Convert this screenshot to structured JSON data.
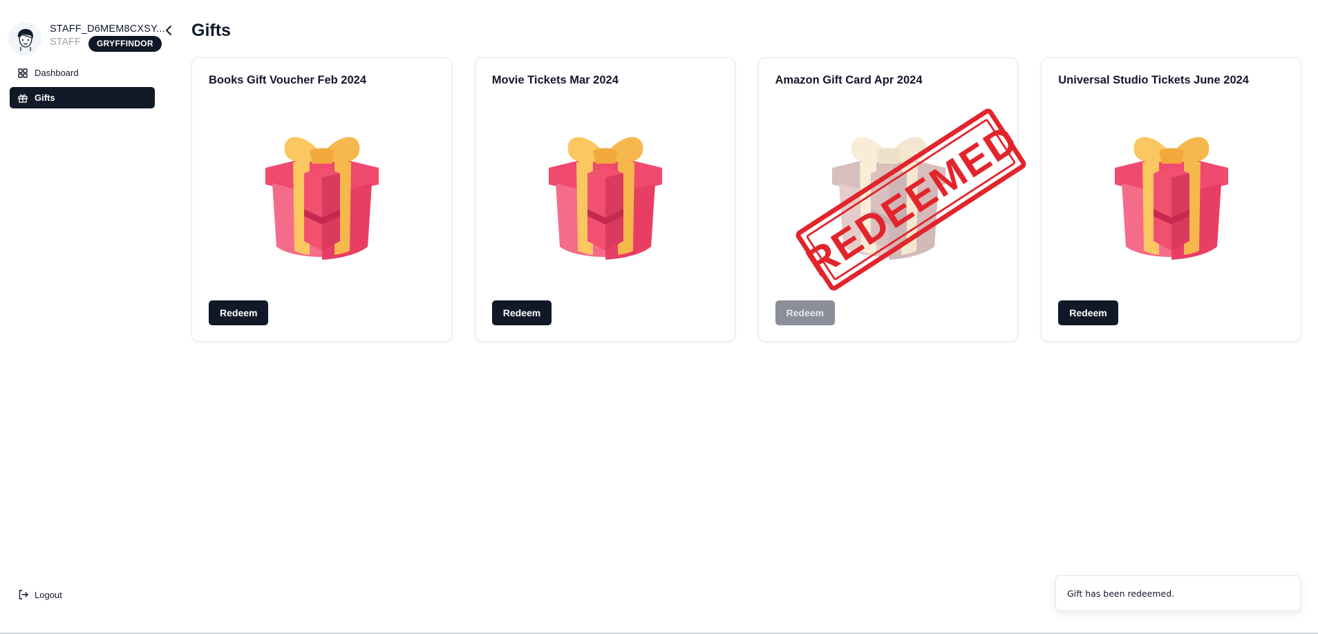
{
  "sidebar": {
    "user": {
      "name": "STAFF_D6MEM8CXSY...",
      "role": "STAFF",
      "house": "GRYFFINDOR"
    },
    "nav": [
      {
        "label": "Dashboard",
        "icon": "dashboard-grid-icon",
        "active": false
      },
      {
        "label": "Gifts",
        "icon": "gift-icon",
        "active": true
      }
    ],
    "logout_label": "Logout"
  },
  "main": {
    "title": "Gifts",
    "cards": [
      {
        "title": "Books Gift Voucher Feb 2024",
        "button_label": "Redeem",
        "redeemed": false
      },
      {
        "title": "Movie Tickets Mar 2024",
        "button_label": "Redeem",
        "redeemed": false
      },
      {
        "title": "Amazon Gift Card Apr 2024",
        "button_label": "Redeem",
        "redeemed": true,
        "stamp_text": "REDEEMED"
      },
      {
        "title": "Universal Studio Tickets June 2024",
        "button_label": "Redeem",
        "redeemed": false
      }
    ]
  },
  "toast": {
    "message": "Gift has been redeemed."
  },
  "colors": {
    "primary": "#111827",
    "disabled_button": "#8b8f99",
    "stamp_red": "#e3242b",
    "gift_pink": "#f04a6e",
    "gift_ribbon": "#fbc760"
  }
}
